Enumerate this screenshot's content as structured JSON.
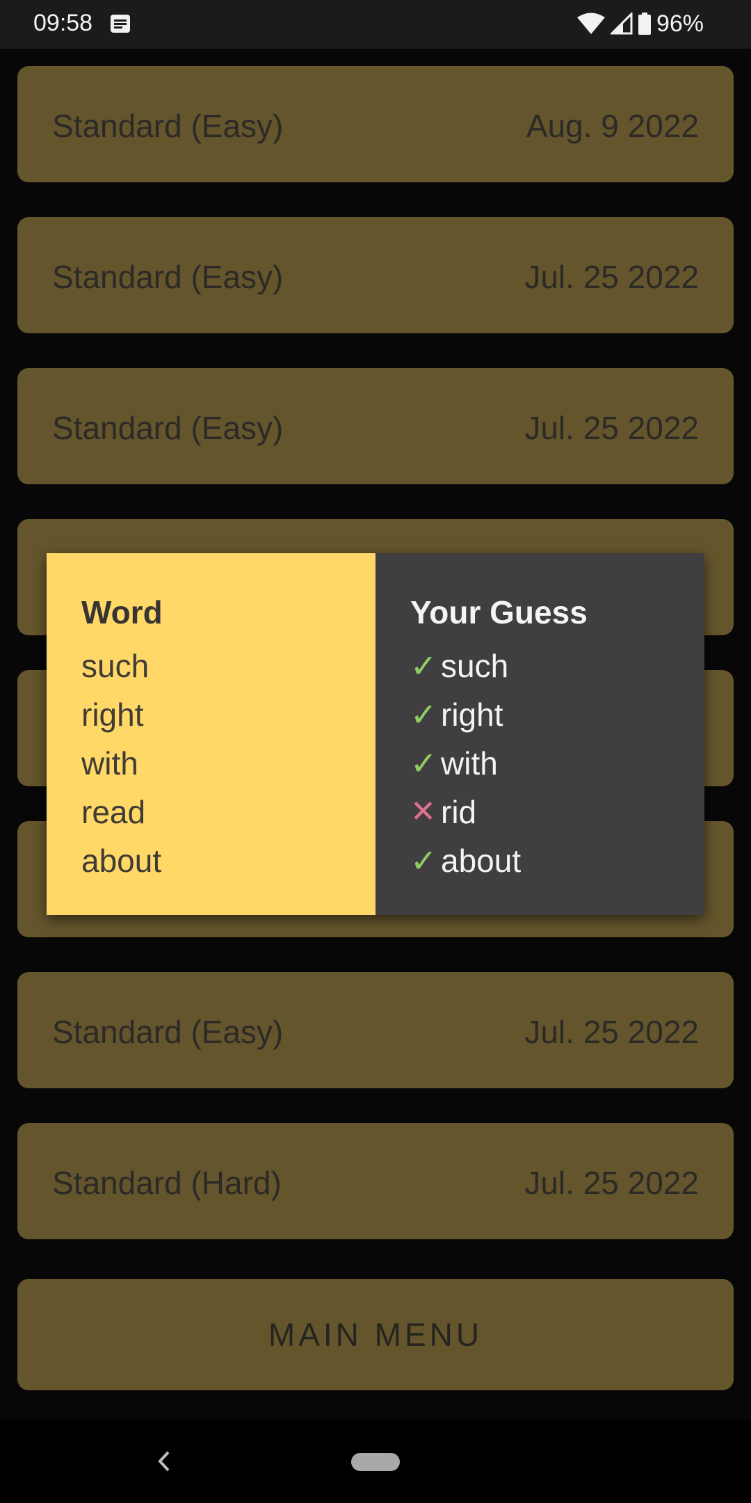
{
  "status_bar": {
    "time": "09:58",
    "battery": "96%"
  },
  "list": [
    {
      "mode": "Standard (Easy)",
      "date": "Aug. 9 2022"
    },
    {
      "mode": "Standard (Easy)",
      "date": "Jul. 25 2022"
    },
    {
      "mode": "Standard (Easy)",
      "date": "Jul. 25 2022"
    },
    {
      "mode": "",
      "date": ""
    },
    {
      "mode": "",
      "date": ""
    },
    {
      "mode": "",
      "date": ""
    },
    {
      "mode": "Standard (Easy)",
      "date": "Jul. 25 2022"
    },
    {
      "mode": "Standard (Hard)",
      "date": "Jul. 25 2022"
    }
  ],
  "main_menu_label": "MAIN MENU",
  "dialog": {
    "word_header": "Word",
    "guess_header": "Your Guess",
    "words": [
      "such",
      "right",
      "with",
      "read",
      "about"
    ],
    "guesses": [
      "such",
      "right",
      "with",
      "rid",
      "about"
    ],
    "correct": [
      true,
      true,
      true,
      false,
      true
    ],
    "check_mark": "✓",
    "cross_mark": "✕"
  },
  "colors": {
    "background": "#070707",
    "item": "#65552c",
    "word_column": "#ffd868",
    "guess_column": "#403e40",
    "correct": "#8fce62",
    "incorrect": "#e0718f"
  },
  "icons": {
    "status": [
      "notification-icon",
      "wifi-icon",
      "signal-icon",
      "battery-icon"
    ],
    "nav": [
      "back-icon",
      "home-pill-icon"
    ]
  }
}
